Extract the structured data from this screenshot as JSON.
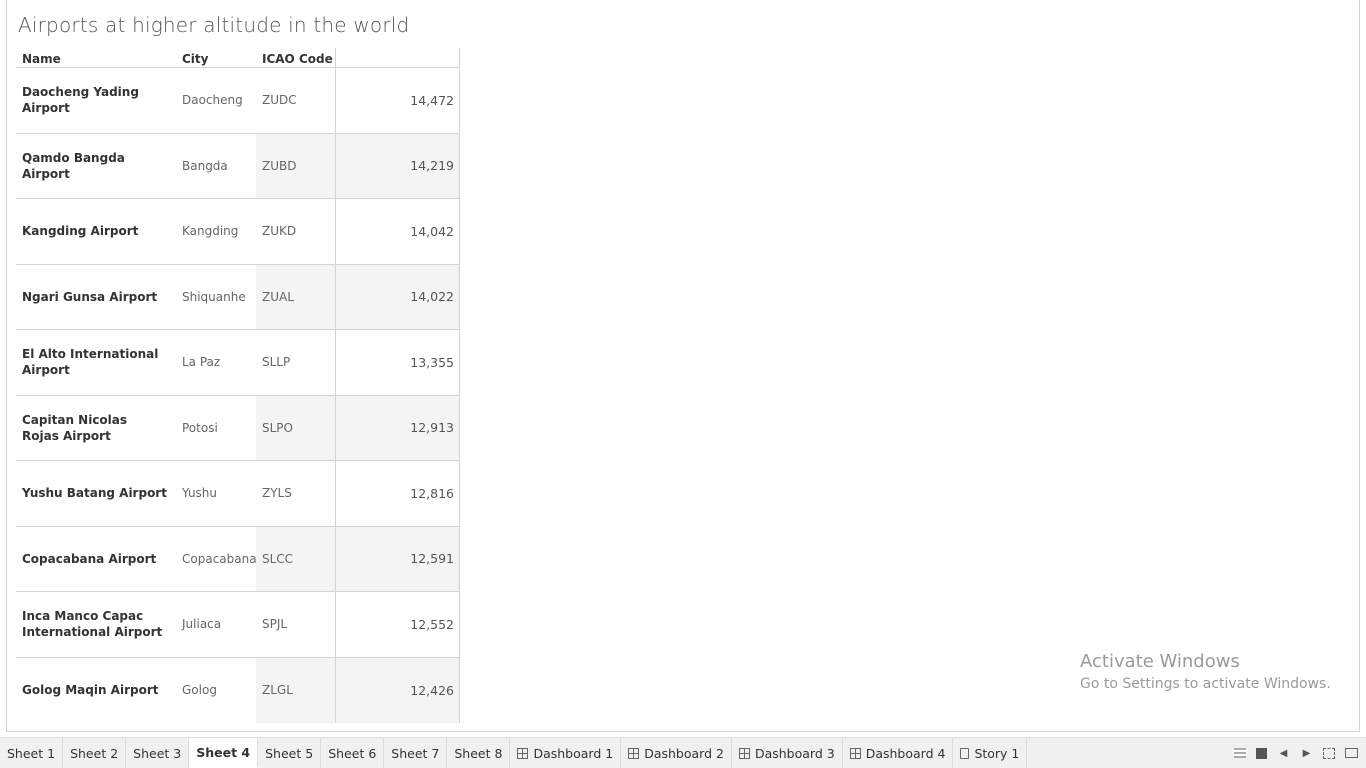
{
  "sheet": {
    "title": "Airports at higher altitude in the world"
  },
  "table": {
    "headers": {
      "name": "Name",
      "city": "City",
      "icao": "ICAO Code",
      "value": ""
    },
    "rows": [
      {
        "name": "Daocheng Yading Airport",
        "city": "Daocheng",
        "icao": "ZUDC",
        "value": "14,472"
      },
      {
        "name": "Qamdo Bangda Airport",
        "city": "Bangda",
        "icao": "ZUBD",
        "value": "14,219"
      },
      {
        "name": "Kangding Airport",
        "city": "Kangding",
        "icao": "ZUKD",
        "value": "14,042"
      },
      {
        "name": "Ngari Gunsa Airport",
        "city": "Shiquanhe",
        "icao": "ZUAL",
        "value": "14,022"
      },
      {
        "name": "El Alto International Airport",
        "city": "La Paz",
        "icao": "SLLP",
        "value": "13,355"
      },
      {
        "name": "Capitan Nicolas Rojas Airport",
        "city": "Potosi",
        "icao": "SLPO",
        "value": "12,913"
      },
      {
        "name": "Yushu Batang Airport",
        "city": "Yushu",
        "icao": "ZYLS",
        "value": "12,816"
      },
      {
        "name": "Copacabana Airport",
        "city": "Copacabana",
        "icao": "SLCC",
        "value": "12,591"
      },
      {
        "name": "Inca Manco Capac International Airport",
        "city": "Juliaca",
        "icao": "SPJL",
        "value": "12,552"
      },
      {
        "name": "Golog Maqin Airport",
        "city": "Golog",
        "icao": "ZLGL",
        "value": "12,426"
      }
    ]
  },
  "watermark": {
    "title": "Activate Windows",
    "subtitle": "Go to Settings to activate Windows."
  },
  "tabs": [
    {
      "label": "Sheet 1",
      "icon": "",
      "active": false
    },
    {
      "label": "Sheet 2",
      "icon": "",
      "active": false
    },
    {
      "label": "Sheet 3",
      "icon": "",
      "active": false
    },
    {
      "label": "Sheet 4",
      "icon": "",
      "active": true
    },
    {
      "label": "Sheet 5",
      "icon": "",
      "active": false
    },
    {
      "label": "Sheet 6",
      "icon": "",
      "active": false
    },
    {
      "label": "Sheet 7",
      "icon": "",
      "active": false
    },
    {
      "label": "Sheet 8",
      "icon": "",
      "active": false
    },
    {
      "label": "Dashboard 1",
      "icon": "dashboard-icon",
      "active": false
    },
    {
      "label": "Dashboard 2",
      "icon": "dashboard-icon",
      "active": false
    },
    {
      "label": "Dashboard 3",
      "icon": "dashboard-icon",
      "active": false
    },
    {
      "label": "Dashboard 4",
      "icon": "dashboard-icon",
      "active": false
    },
    {
      "label": "Story 1",
      "icon": "story-icon",
      "active": false
    }
  ]
}
